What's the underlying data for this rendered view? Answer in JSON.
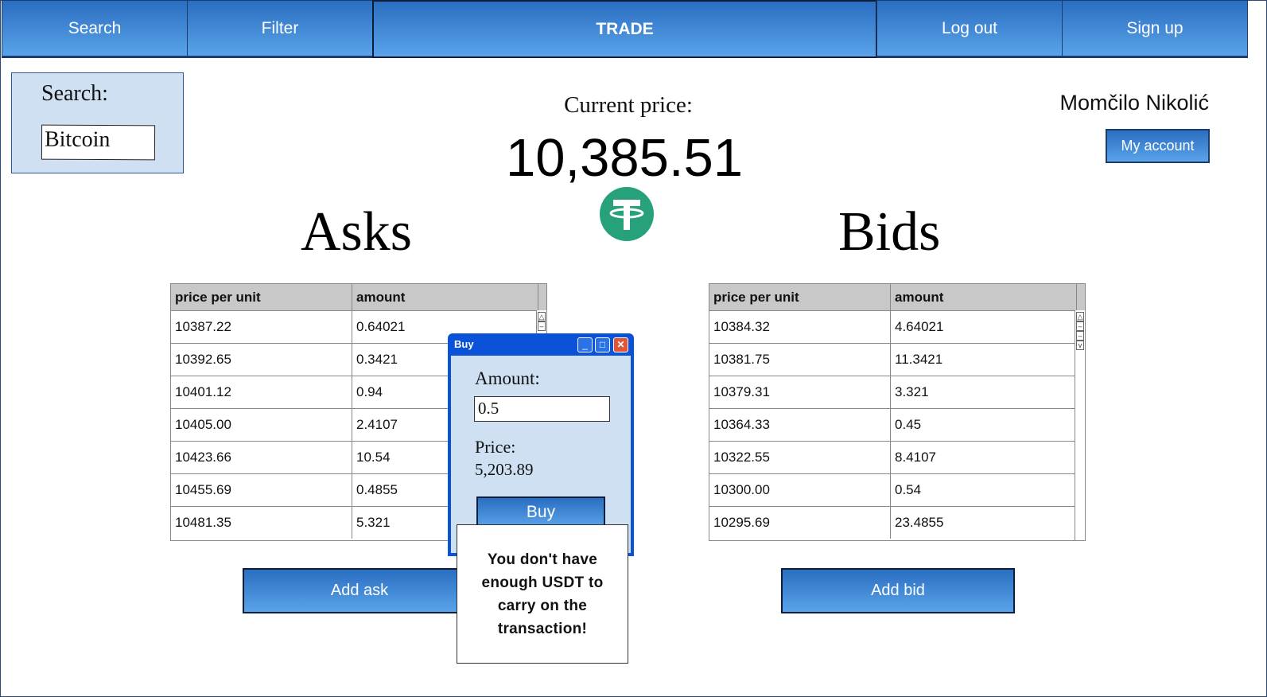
{
  "nav": {
    "search": "Search",
    "filter": "Filter",
    "trade": "TRADE",
    "logout": "Log out",
    "signup": "Sign up"
  },
  "search": {
    "label": "Search:",
    "value": "Bitcoin"
  },
  "price": {
    "label": "Current price:",
    "value": "10,385.51",
    "currency_icon": "tether-icon"
  },
  "account": {
    "user_name": "Momčilo Nikolić",
    "my_account": "My account"
  },
  "asks": {
    "heading": "Asks",
    "columns": [
      "price per unit",
      "amount"
    ],
    "rows": [
      [
        "10387.22",
        "0.64021"
      ],
      [
        "10392.65",
        "0.3421"
      ],
      [
        "10401.12",
        "0.94"
      ],
      [
        "10405.00",
        "2.4107"
      ],
      [
        "10423.66",
        "10.54"
      ],
      [
        "10455.69",
        "0.4855"
      ],
      [
        "10481.35",
        "5.321"
      ]
    ],
    "add_button": "Add ask"
  },
  "bids": {
    "heading": "Bids",
    "columns": [
      "price per unit",
      "amount"
    ],
    "rows": [
      [
        "10384.32",
        "4.64021"
      ],
      [
        "10381.75",
        "11.3421"
      ],
      [
        "10379.31",
        "3.321"
      ],
      [
        "10364.33",
        "0.45"
      ],
      [
        "10322.55",
        "8.4107"
      ],
      [
        "10300.00",
        "0.54"
      ],
      [
        "10295.69",
        "23.4855"
      ]
    ],
    "add_button": "Add bid"
  },
  "dialog": {
    "title": "Buy",
    "amount_label": "Amount:",
    "amount_value": "0.5",
    "price_label": "Price:",
    "price_value": "5,203.89",
    "buy_button": "Buy",
    "error": "You don't have enough USDT to carry on the transaction!"
  },
  "colors": {
    "accent": "#2a6ec0",
    "panel": "#cfe0f3",
    "tether": "#26a17b",
    "dialog_frame": "#0a52d8"
  }
}
